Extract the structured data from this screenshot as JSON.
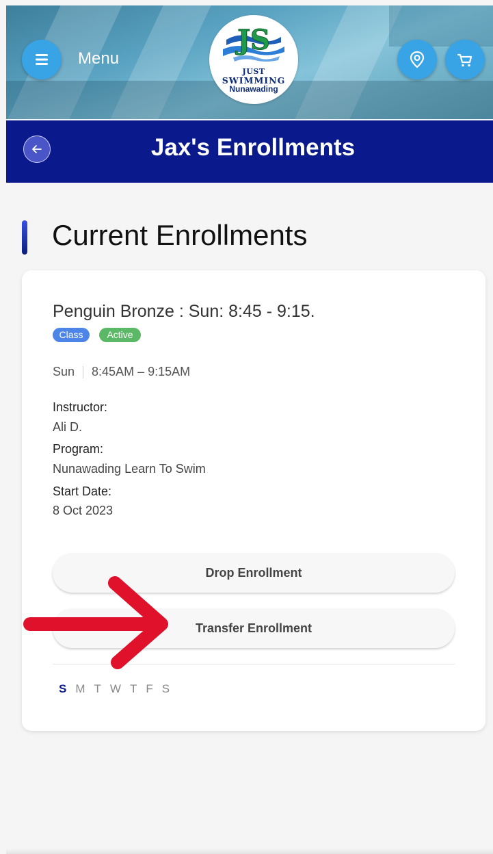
{
  "header": {
    "menu_label": "Menu",
    "logo": {
      "line1": "JUST",
      "line2": "SWIMMING",
      "line3": "Nunawading",
      "monogram": "JS"
    },
    "icons": [
      "menu-icon",
      "location-pin-icon",
      "cart-icon"
    ]
  },
  "title_bar": {
    "title": "Jax's Enrollments",
    "back_icon": "arrow-left-icon"
  },
  "section": {
    "title": "Current Enrollments"
  },
  "enrollment": {
    "title": "Penguin Bronze : Sun: 8:45 - 9:15.",
    "tags": {
      "class": "Class",
      "active": "Active"
    },
    "schedule": {
      "day": "Sun",
      "time": "8:45AM – 9:15AM"
    },
    "instructor_label": "Instructor:",
    "instructor": "Ali D.",
    "program_label": "Program:",
    "program": "Nunawading Learn To Swim",
    "start_label": "Start Date:",
    "start_date": "8 Oct 2023",
    "drop_label": "Drop Enrollment",
    "transfer_label": "Transfer Enrollment",
    "days": [
      "S",
      "M",
      "T",
      "W",
      "T",
      "F",
      "S"
    ],
    "active_day_index": 0
  },
  "colors": {
    "nav_blue": "#0a1a8c",
    "button_blue": "#38a3e5",
    "tag_class": "#4d84e8",
    "tag_active": "#5bb867",
    "annotation_arrow": "#e0112a"
  }
}
